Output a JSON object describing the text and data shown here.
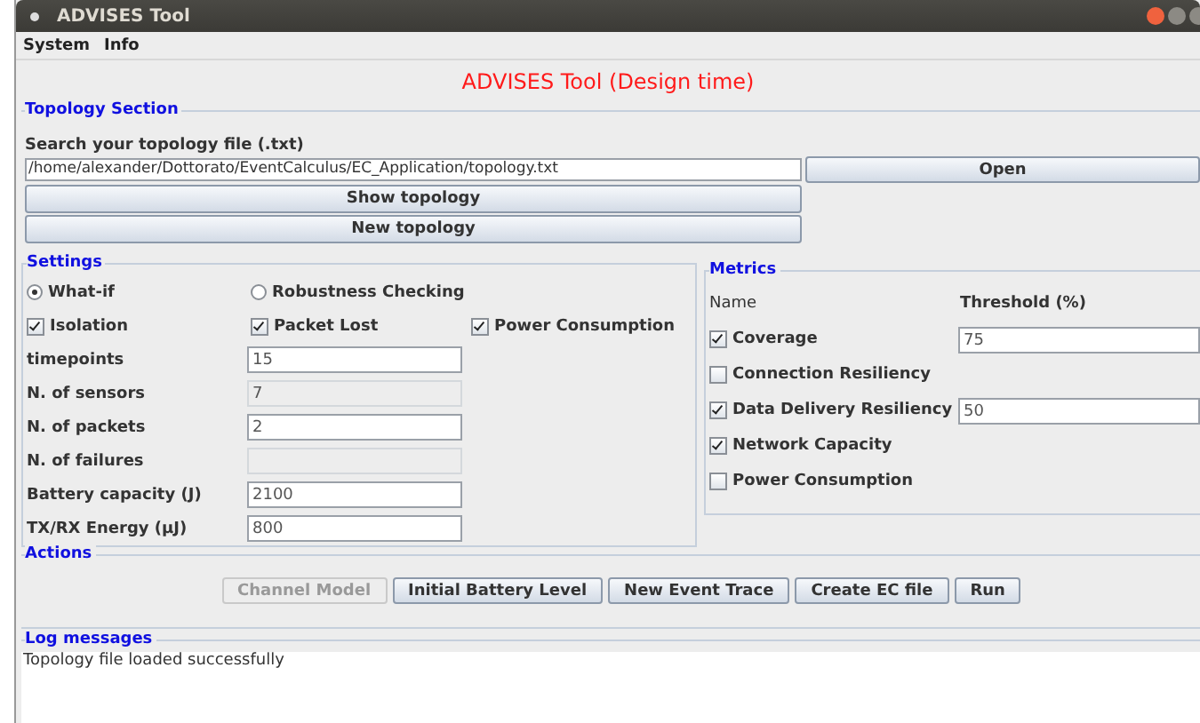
{
  "window": {
    "title": "ADVISES Tool"
  },
  "menu": [
    "System",
    "Info"
  ],
  "heading": "ADVISES Tool (Design time)",
  "topology": {
    "title": "Topology Section",
    "label": "Search your topology file (.txt)",
    "path": "/home/alexander/Dottorato/EventCalculus/EC_Application/topology.txt",
    "open": "Open",
    "buttons": [
      "Show topology",
      "New topology"
    ]
  },
  "settings": {
    "title": "Settings",
    "modes": [
      {
        "label": "What-if",
        "selected": true
      },
      {
        "label": "Robustness Checking",
        "selected": false
      }
    ],
    "options": [
      {
        "label": "Isolation",
        "checked": true
      },
      {
        "label": "Packet Lost",
        "checked": true
      },
      {
        "label": "Power Consumption",
        "checked": true
      }
    ],
    "fields": [
      {
        "label": "timepoints",
        "value": "15",
        "disabled": false
      },
      {
        "label": "N. of sensors",
        "value": "7",
        "disabled": true
      },
      {
        "label": "N. of packets",
        "value": "2",
        "disabled": false
      },
      {
        "label": "N. of failures",
        "disabled": true
      },
      {
        "label": "Battery capacity (J)",
        "value": "2100",
        "disabled": false
      },
      {
        "label": "TX/RX Energy (µJ)",
        "value": "800",
        "disabled": false
      }
    ]
  },
  "metrics": {
    "title": "Metrics",
    "name_header": "Name",
    "threshold_header": "Threshold (%)",
    "items": [
      {
        "label": "Coverage",
        "checked": true,
        "threshold": "75"
      },
      {
        "label": "Connection Resiliency",
        "checked": false
      },
      {
        "label": "Data Delivery Resiliency",
        "checked": true,
        "threshold": "50"
      },
      {
        "label": "Network Capacity",
        "checked": true
      },
      {
        "label": "Power Consumption",
        "checked": false
      }
    ]
  },
  "actions": {
    "title": "Actions",
    "buttons": [
      {
        "label": "Channel Model",
        "disabled": true
      },
      {
        "label": "Initial Battery Level",
        "disabled": false
      },
      {
        "label": "New Event Trace",
        "disabled": false
      },
      {
        "label": "Create EC file",
        "disabled": false
      },
      {
        "label": "Run",
        "disabled": false
      }
    ]
  },
  "log": {
    "title": "Log messages",
    "messages": [
      "Topology file loaded successfully"
    ]
  }
}
